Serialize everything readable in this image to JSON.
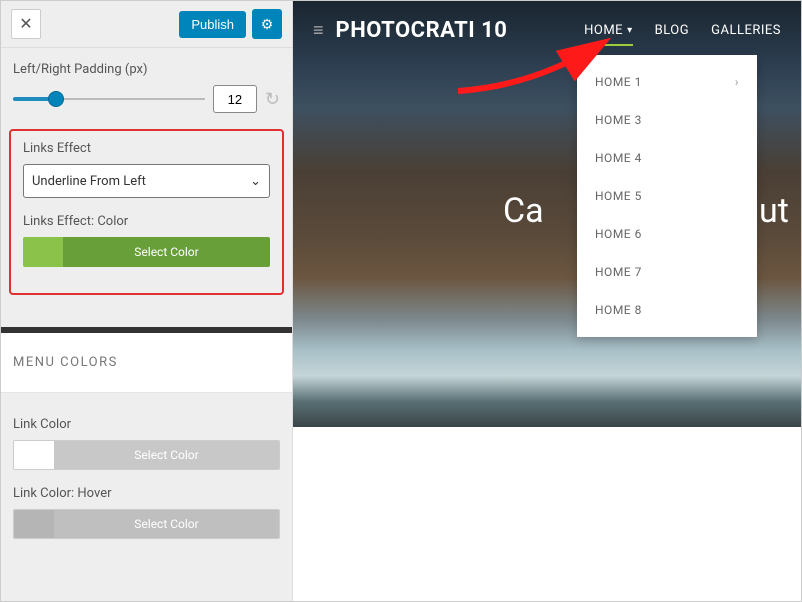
{
  "header": {
    "publish_label": "Publish"
  },
  "sidebar": {
    "padding_label": "Left/Right Padding (px)",
    "padding_value": "12",
    "links_effect_label": "Links Effect",
    "links_effect_value": "Underline From Left",
    "links_effect_color_label": "Links Effect: Color",
    "select_color": "Select Color",
    "menu_colors_title": "MENU COLORS",
    "link_color_label": "Link Color",
    "link_color_hover_label": "Link Color: Hover"
  },
  "preview": {
    "logo": "PHOTOCRATI 10",
    "nav": {
      "home": "HOME",
      "blog": "BLOG",
      "galleries": "GALLERIES"
    },
    "dropdown_items": [
      {
        "label": "HOME 1",
        "has_submenu": true
      },
      {
        "label": "HOME 3",
        "has_submenu": false
      },
      {
        "label": "HOME 4",
        "has_submenu": false
      },
      {
        "label": "HOME 5",
        "has_submenu": false
      },
      {
        "label": "HOME 6",
        "has_submenu": false
      },
      {
        "label": "HOME 7",
        "has_submenu": false
      },
      {
        "label": "HOME 8",
        "has_submenu": false
      }
    ],
    "hero_title_left": "Ca",
    "hero_title_right": "aut"
  },
  "colors": {
    "accent_blue": "#0085ba",
    "highlight_red": "#e03131",
    "lime": "#9ccc3c",
    "green": "#689f38"
  }
}
